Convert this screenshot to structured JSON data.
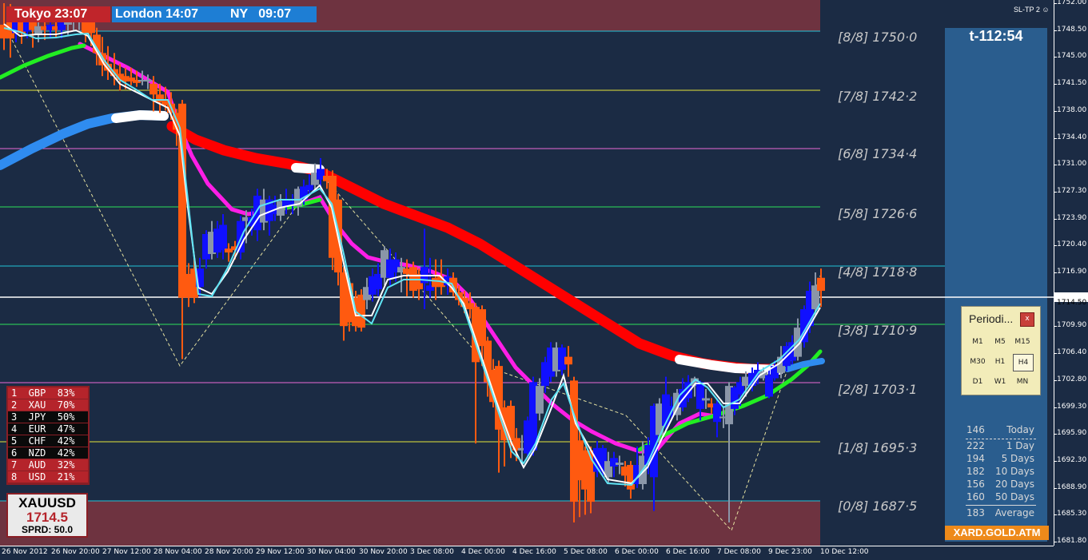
{
  "sessions": {
    "tokyo": "Tokyo 23:07",
    "london": "London 14:07",
    "ny": "NY   09:07"
  },
  "indicator_label": "SL-TP 2",
  "countdown": "t-112:54",
  "murrey_levels": [
    "[8/8] 1750·0",
    "[7/8] 1742·2",
    "[6/8] 1734·4",
    "[5/8] 1726·6",
    "[4/8] 1718·8",
    "[3/8] 1710·9",
    "[2/8] 1703·1",
    "[1/8] 1695·3",
    "[0/8] 1687·5"
  ],
  "price_axis": [
    "1752.00",
    "1748.50",
    "1745.00",
    "1741.50",
    "1738.00",
    "1734.40",
    "1731.00",
    "1727.30",
    "1723.90",
    "1720.40",
    "1716.90",
    "1713.40",
    "1709.90",
    "1706.40",
    "1702.80",
    "1699.30",
    "1695.90",
    "1692.30",
    "1688.90",
    "1685.30",
    "1681.80"
  ],
  "current_price_label": "1714.50",
  "time_axis": [
    "26 Nov 2012",
    "26 Nov 20:00",
    "27 Nov 12:00",
    "28 Nov 04:00",
    "28 Nov 20:00",
    "29 Nov 12:00",
    "30 Nov 04:00",
    "30 Nov 20:00",
    "3 Dec 08:00",
    "4 Dec 00:00",
    "4 Dec 16:00",
    "5 Dec 08:00",
    "6 Dec 00:00",
    "6 Dec 16:00",
    "7 Dec 08:00",
    "9 Dec 23:00",
    "10 Dec 12:00"
  ],
  "currency_strength": [
    {
      "text": "1  GBP  83%",
      "color": "#b5242b"
    },
    {
      "text": "2  XAU  70%",
      "color": "#b5242b"
    },
    {
      "text": "3  JPY  50%",
      "color": "#0a0a0a"
    },
    {
      "text": "4  EUR  47%",
      "color": "#0a0a0a"
    },
    {
      "text": "5  CHF  42%",
      "color": "#0a0a0a"
    },
    {
      "text": "6  NZD  42%",
      "color": "#0a0a0a"
    },
    {
      "text": "7  AUD  32%",
      "color": "#b5242b"
    },
    {
      "text": "8  USD  21%",
      "color": "#b5242b"
    }
  ],
  "symbol_box": {
    "symbol": "XAUUSD",
    "price": "1714.5",
    "spread": "SPRD: 50.0"
  },
  "periodicity": {
    "title": "Periodi...",
    "close": "x",
    "buttons": [
      "M1",
      "M5",
      "M15",
      "M30",
      "H1",
      "H4",
      "D1",
      "W1",
      "MN"
    ],
    "active": "H4"
  },
  "range_stats": [
    {
      "value": "146",
      "label": "Today"
    },
    {
      "value": "222",
      "label": "1 Day"
    },
    {
      "value": "194",
      "label": "5 Days"
    },
    {
      "value": "182",
      "label": "10 Days"
    },
    {
      "value": "156",
      "label": "20 Days"
    },
    {
      "value": "160",
      "label": "50 Days"
    },
    {
      "value": "183",
      "label": "Average"
    }
  ],
  "brand": "XARD.GOLD.ATM",
  "colors": {
    "background": "#1b2b44",
    "bull": "#1010ff",
    "bear": "#ff5a10",
    "neutral": "#8a96a8",
    "ma_red": "#ff0000",
    "ma_magenta": "#ff1ee6",
    "ma_green": "#22ee22",
    "ma_blue": "#2f8cf0",
    "panel": "#2a5d8e",
    "zone": "#6e3340"
  },
  "chart_data": {
    "type": "candlestick",
    "symbol": "XAUUSD",
    "timeframe": "H4",
    "ylim": [
      1681.8,
      1752.0
    ],
    "murrey": [
      1750.0,
      1742.2,
      1734.4,
      1726.6,
      1718.8,
      1710.9,
      1703.1,
      1695.3,
      1687.5
    ],
    "current_price": 1714.5,
    "candles": [
      {
        "x": 5,
        "o": 1749.2,
        "c": 1747.4,
        "h": 1752.0,
        "l": 1745.9
      },
      {
        "x": 13,
        "o": 1750.5,
        "c": 1747.4,
        "h": 1751.9,
        "l": 1744.9
      },
      {
        "x": 20,
        "o": 1748.1,
        "c": 1750.2,
        "h": 1750.9,
        "l": 1746.9
      },
      {
        "x": 27,
        "o": 1749.7,
        "c": 1748.1,
        "h": 1750.4,
        "l": 1746.7
      },
      {
        "x": 34,
        "o": 1748.3,
        "c": 1749.5,
        "h": 1751.4,
        "l": 1747.4
      },
      {
        "x": 41,
        "o": 1749.5,
        "c": 1748.5,
        "h": 1750.2,
        "l": 1746.2
      },
      {
        "x": 48,
        "o": 1748.0,
        "c": 1749.0,
        "h": 1750.2,
        "l": 1746.9
      },
      {
        "x": 56,
        "o": 1749.0,
        "c": 1748.5,
        "h": 1750.2,
        "l": 1747.2
      },
      {
        "x": 63,
        "o": 1748.5,
        "c": 1749.2,
        "h": 1750.4,
        "l": 1747.4
      },
      {
        "x": 70,
        "o": 1749.0,
        "c": 1748.5,
        "h": 1750.2,
        "l": 1747.6
      },
      {
        "x": 77,
        "o": 1748.5,
        "c": 1749.5,
        "h": 1750.4,
        "l": 1747.4
      },
      {
        "x": 85,
        "o": 1749.2,
        "c": 1749.5,
        "h": 1750.7,
        "l": 1747.9
      },
      {
        "x": 92,
        "o": 1749.7,
        "c": 1750.0,
        "h": 1751.2,
        "l": 1748.5
      },
      {
        "x": 99,
        "o": 1749.7,
        "c": 1749.5,
        "h": 1750.7,
        "l": 1748.5
      },
      {
        "x": 107,
        "o": 1750.0,
        "c": 1747.9,
        "h": 1750.7,
        "l": 1746.9
      },
      {
        "x": 114,
        "o": 1750.2,
        "c": 1748.1,
        "h": 1750.4,
        "l": 1746.4
      },
      {
        "x": 121,
        "o": 1747.9,
        "c": 1745.5,
        "h": 1748.8,
        "l": 1743.9
      },
      {
        "x": 128,
        "o": 1745.5,
        "c": 1743.9,
        "h": 1747.6,
        "l": 1742.5
      },
      {
        "x": 135,
        "o": 1744.1,
        "c": 1743.2,
        "h": 1746.4,
        "l": 1742.0
      },
      {
        "x": 143,
        "o": 1743.4,
        "c": 1742.5,
        "h": 1745.5,
        "l": 1741.3
      },
      {
        "x": 150,
        "o": 1742.8,
        "c": 1742.0,
        "h": 1744.1,
        "l": 1740.6
      },
      {
        "x": 157,
        "o": 1742.5,
        "c": 1741.8,
        "h": 1743.6,
        "l": 1740.8
      },
      {
        "x": 164,
        "o": 1742.3,
        "c": 1741.8,
        "h": 1743.6,
        "l": 1741.3
      },
      {
        "x": 171,
        "o": 1742.0,
        "c": 1741.6,
        "h": 1743.2,
        "l": 1741.1
      },
      {
        "x": 178,
        "o": 1742.0,
        "c": 1741.8,
        "h": 1743.2,
        "l": 1741.3
      },
      {
        "x": 185,
        "o": 1742.0,
        "c": 1741.8,
        "h": 1742.7,
        "l": 1740.8
      },
      {
        "x": 192,
        "o": 1741.5,
        "c": 1740.1,
        "h": 1742.5,
        "l": 1737.9
      },
      {
        "x": 200,
        "o": 1740.1,
        "c": 1739.1,
        "h": 1741.5,
        "l": 1737.7
      },
      {
        "x": 207,
        "o": 1739.4,
        "c": 1738.7,
        "h": 1741.1,
        "l": 1738.0
      },
      {
        "x": 214,
        "o": 1738.9,
        "c": 1737.7,
        "h": 1740.4,
        "l": 1736.8
      },
      {
        "x": 221,
        "o": 1737.7,
        "c": 1735.5,
        "h": 1738.2,
        "l": 1733.4
      },
      {
        "x": 228,
        "o": 1738.9,
        "c": 1713.6,
        "h": 1739.4,
        "l": 1705.6
      },
      {
        "x": 236,
        "o": 1716.7,
        "c": 1713.6,
        "h": 1718.1,
        "l": 1712.4
      },
      {
        "x": 243,
        "o": 1717.4,
        "c": 1713.6,
        "h": 1718.8,
        "l": 1712.9
      },
      {
        "x": 250,
        "o": 1715.0,
        "c": 1717.4,
        "h": 1718.8,
        "l": 1713.8
      },
      {
        "x": 258,
        "o": 1718.6,
        "c": 1721.9,
        "h": 1722.4,
        "l": 1717.4
      },
      {
        "x": 265,
        "o": 1719.3,
        "c": 1722.2,
        "h": 1723.6,
        "l": 1718.6
      },
      {
        "x": 272,
        "o": 1719.5,
        "c": 1722.6,
        "h": 1723.6,
        "l": 1718.8
      },
      {
        "x": 279,
        "o": 1719.8,
        "c": 1723.1,
        "h": 1724.5,
        "l": 1718.6
      },
      {
        "x": 286,
        "o": 1720.0,
        "c": 1719.5,
        "h": 1720.7,
        "l": 1718.3
      },
      {
        "x": 294,
        "o": 1720.3,
        "c": 1719.8,
        "h": 1721.0,
        "l": 1718.6
      },
      {
        "x": 301,
        "o": 1719.5,
        "c": 1723.6,
        "h": 1724.3,
        "l": 1718.6
      },
      {
        "x": 308,
        "o": 1723.6,
        "c": 1724.1,
        "h": 1725.0,
        "l": 1720.7
      },
      {
        "x": 315,
        "o": 1722.9,
        "c": 1724.1,
        "h": 1725.2,
        "l": 1721.7
      },
      {
        "x": 322,
        "o": 1722.4,
        "c": 1726.9,
        "h": 1727.8,
        "l": 1721.0
      },
      {
        "x": 330,
        "o": 1723.4,
        "c": 1726.4,
        "h": 1727.8,
        "l": 1722.4
      },
      {
        "x": 337,
        "o": 1723.6,
        "c": 1726.4,
        "h": 1726.9,
        "l": 1721.7
      },
      {
        "x": 344,
        "o": 1724.5,
        "c": 1725.7,
        "h": 1726.9,
        "l": 1723.6
      },
      {
        "x": 351,
        "o": 1724.3,
        "c": 1726.2,
        "h": 1727.1,
        "l": 1723.6
      },
      {
        "x": 358,
        "o": 1725.5,
        "c": 1726.4,
        "h": 1727.8,
        "l": 1724.5
      },
      {
        "x": 366,
        "o": 1725.7,
        "c": 1726.2,
        "h": 1727.1,
        "l": 1724.5
      },
      {
        "x": 373,
        "o": 1725.5,
        "c": 1727.8,
        "h": 1728.1,
        "l": 1724.3
      },
      {
        "x": 380,
        "o": 1726.4,
        "c": 1728.1,
        "h": 1729.0,
        "l": 1725.7
      },
      {
        "x": 387,
        "o": 1727.6,
        "c": 1728.3,
        "h": 1729.7,
        "l": 1726.9
      },
      {
        "x": 394,
        "o": 1728.3,
        "c": 1729.9,
        "h": 1731.1,
        "l": 1727.6
      },
      {
        "x": 401,
        "o": 1729.0,
        "c": 1730.4,
        "h": 1731.8,
        "l": 1727.8
      },
      {
        "x": 409,
        "o": 1729.5,
        "c": 1728.8,
        "h": 1730.4,
        "l": 1727.8
      },
      {
        "x": 416,
        "o": 1729.5,
        "c": 1718.8,
        "h": 1730.2,
        "l": 1717.2
      },
      {
        "x": 423,
        "o": 1726.4,
        "c": 1716.9,
        "h": 1727.1,
        "l": 1715.2
      },
      {
        "x": 430,
        "o": 1716.9,
        "c": 1709.9,
        "h": 1717.6,
        "l": 1708.0
      },
      {
        "x": 437,
        "o": 1715.5,
        "c": 1710.4,
        "h": 1716.2,
        "l": 1709.2
      },
      {
        "x": 445,
        "o": 1713.6,
        "c": 1709.9,
        "h": 1714.5,
        "l": 1709.2
      },
      {
        "x": 452,
        "o": 1714.0,
        "c": 1709.7,
        "h": 1714.7,
        "l": 1709.2
      },
      {
        "x": 459,
        "o": 1713.3,
        "c": 1715.0,
        "h": 1716.2,
        "l": 1712.1
      },
      {
        "x": 466,
        "o": 1714.0,
        "c": 1716.4,
        "h": 1717.4,
        "l": 1713.1
      },
      {
        "x": 473,
        "o": 1714.7,
        "c": 1716.7,
        "h": 1718.1,
        "l": 1713.8
      },
      {
        "x": 481,
        "o": 1716.2,
        "c": 1719.8,
        "h": 1720.3,
        "l": 1715.2
      },
      {
        "x": 488,
        "o": 1716.2,
        "c": 1718.6,
        "h": 1720.0,
        "l": 1715.2
      },
      {
        "x": 495,
        "o": 1716.9,
        "c": 1718.6,
        "h": 1719.5,
        "l": 1715.7
      },
      {
        "x": 502,
        "o": 1716.9,
        "c": 1717.6,
        "h": 1718.8,
        "l": 1714.3
      },
      {
        "x": 509,
        "o": 1717.4,
        "c": 1716.7,
        "h": 1718.6,
        "l": 1713.8
      },
      {
        "x": 517,
        "o": 1717.6,
        "c": 1714.5,
        "h": 1718.3,
        "l": 1713.6
      },
      {
        "x": 524,
        "o": 1716.7,
        "c": 1714.7,
        "h": 1717.4,
        "l": 1713.3
      },
      {
        "x": 531,
        "o": 1715.5,
        "c": 1717.6,
        "h": 1722.6,
        "l": 1712.1
      },
      {
        "x": 538,
        "o": 1714.5,
        "c": 1715.2,
        "h": 1718.8,
        "l": 1713.6
      },
      {
        "x": 545,
        "o": 1716.2,
        "c": 1715.0,
        "h": 1718.6,
        "l": 1713.3
      },
      {
        "x": 552,
        "o": 1716.4,
        "c": 1715.0,
        "h": 1718.6,
        "l": 1714.0
      },
      {
        "x": 560,
        "o": 1715.2,
        "c": 1716.4,
        "h": 1717.4,
        "l": 1714.0
      },
      {
        "x": 567,
        "o": 1716.2,
        "c": 1714.3,
        "h": 1716.9,
        "l": 1713.8
      },
      {
        "x": 574,
        "o": 1714.3,
        "c": 1713.3,
        "h": 1715.2,
        "l": 1712.6
      },
      {
        "x": 581,
        "o": 1713.6,
        "c": 1712.4,
        "h": 1714.5,
        "l": 1711.6
      },
      {
        "x": 588,
        "o": 1712.9,
        "c": 1712.1,
        "h": 1714.3,
        "l": 1710.9
      },
      {
        "x": 595,
        "o": 1712.4,
        "c": 1705.2,
        "h": 1712.9,
        "l": 1694.6
      },
      {
        "x": 603,
        "o": 1712.1,
        "c": 1707.3,
        "h": 1712.6,
        "l": 1704.7
      },
      {
        "x": 610,
        "o": 1708.0,
        "c": 1702.6,
        "h": 1708.5,
        "l": 1700.7
      },
      {
        "x": 617,
        "o": 1704.2,
        "c": 1700.0,
        "h": 1705.6,
        "l": 1699.3
      },
      {
        "x": 624,
        "o": 1704.7,
        "c": 1696.4,
        "h": 1705.4,
        "l": 1690.8
      },
      {
        "x": 631,
        "o": 1699.3,
        "c": 1695.0,
        "h": 1700.2,
        "l": 1691.6
      },
      {
        "x": 639,
        "o": 1699.5,
        "c": 1695.0,
        "h": 1700.2,
        "l": 1692.7
      },
      {
        "x": 646,
        "o": 1695.3,
        "c": 1693.7,
        "h": 1696.6,
        "l": 1692.3
      },
      {
        "x": 653,
        "o": 1693.7,
        "c": 1694.0,
        "h": 1695.7,
        "l": 1692.3
      },
      {
        "x": 660,
        "o": 1693.3,
        "c": 1697.6,
        "h": 1698.1,
        "l": 1692.7
      },
      {
        "x": 667,
        "o": 1693.7,
        "c": 1702.6,
        "h": 1703.3,
        "l": 1693.0
      },
      {
        "x": 675,
        "o": 1698.5,
        "c": 1702.1,
        "h": 1703.1,
        "l": 1697.6
      },
      {
        "x": 682,
        "o": 1702.1,
        "c": 1705.2,
        "h": 1705.9,
        "l": 1701.2
      },
      {
        "x": 689,
        "o": 1703.3,
        "c": 1707.1,
        "h": 1707.8,
        "l": 1702.6
      },
      {
        "x": 696,
        "o": 1704.0,
        "c": 1707.1,
        "h": 1707.8,
        "l": 1703.3
      },
      {
        "x": 703,
        "o": 1704.2,
        "c": 1707.1,
        "h": 1707.5,
        "l": 1703.5
      },
      {
        "x": 711,
        "o": 1705.9,
        "c": 1704.9,
        "h": 1707.3,
        "l": 1703.3
      },
      {
        "x": 718,
        "o": 1702.8,
        "c": 1687.0,
        "h": 1703.3,
        "l": 1684.3
      },
      {
        "x": 725,
        "o": 1695.0,
        "c": 1689.8,
        "h": 1696.4,
        "l": 1685.0
      },
      {
        "x": 732,
        "o": 1693.7,
        "c": 1688.6,
        "h": 1694.2,
        "l": 1685.3
      },
      {
        "x": 739,
        "o": 1693.7,
        "c": 1687.0,
        "h": 1694.2,
        "l": 1685.5
      },
      {
        "x": 747,
        "o": 1690.9,
        "c": 1694.0,
        "h": 1694.9,
        "l": 1690.2
      },
      {
        "x": 754,
        "o": 1690.9,
        "c": 1694.0,
        "h": 1694.4,
        "l": 1690.2
      },
      {
        "x": 761,
        "o": 1690.2,
        "c": 1692.3,
        "h": 1693.5,
        "l": 1689.3
      },
      {
        "x": 768,
        "o": 1691.6,
        "c": 1692.7,
        "h": 1693.5,
        "l": 1690.2
      },
      {
        "x": 775,
        "o": 1691.8,
        "c": 1692.1,
        "h": 1693.0,
        "l": 1690.6
      },
      {
        "x": 782,
        "o": 1691.6,
        "c": 1690.4,
        "h": 1692.3,
        "l": 1689.0
      },
      {
        "x": 789,
        "o": 1691.8,
        "c": 1688.6,
        "h": 1692.3,
        "l": 1687.4
      },
      {
        "x": 797,
        "o": 1689.3,
        "c": 1691.8,
        "h": 1694.2,
        "l": 1688.8
      },
      {
        "x": 804,
        "o": 1689.3,
        "c": 1693.0,
        "h": 1694.9,
        "l": 1688.6
      },
      {
        "x": 811,
        "o": 1691.8,
        "c": 1694.4,
        "h": 1695.4,
        "l": 1690.6
      },
      {
        "x": 818,
        "o": 1690.2,
        "c": 1699.5,
        "h": 1699.8,
        "l": 1685.8
      },
      {
        "x": 825,
        "o": 1695.7,
        "c": 1699.8,
        "h": 1700.5,
        "l": 1694.7
      },
      {
        "x": 833,
        "o": 1696.9,
        "c": 1701.0,
        "h": 1703.3,
        "l": 1696.4
      },
      {
        "x": 840,
        "o": 1698.3,
        "c": 1699.5,
        "h": 1700.7,
        "l": 1697.6
      },
      {
        "x": 847,
        "o": 1698.3,
        "c": 1701.2,
        "h": 1701.7,
        "l": 1697.6
      },
      {
        "x": 854,
        "o": 1699.3,
        "c": 1701.7,
        "h": 1703.1,
        "l": 1698.8
      },
      {
        "x": 861,
        "o": 1700.5,
        "c": 1702.6,
        "h": 1703.5,
        "l": 1700.0
      },
      {
        "x": 869,
        "o": 1702.1,
        "c": 1703.1,
        "h": 1703.3,
        "l": 1700.7
      },
      {
        "x": 876,
        "o": 1699.1,
        "c": 1702.6,
        "h": 1702.8,
        "l": 1697.6
      },
      {
        "x": 883,
        "o": 1700.5,
        "c": 1700.2,
        "h": 1701.7,
        "l": 1699.1
      },
      {
        "x": 890,
        "o": 1699.8,
        "c": 1699.3,
        "h": 1700.5,
        "l": 1698.5
      },
      {
        "x": 897,
        "o": 1697.4,
        "c": 1699.8,
        "h": 1700.5,
        "l": 1695.4
      },
      {
        "x": 905,
        "o": 1698.1,
        "c": 1698.1,
        "h": 1699.5,
        "l": 1696.6
      },
      {
        "x": 912,
        "o": 1697.1,
        "c": 1702.1,
        "h": 1702.6,
        "l": 1684.3
      },
      {
        "x": 919,
        "o": 1699.1,
        "c": 1701.9,
        "h": 1702.1,
        "l": 1698.3
      },
      {
        "x": 926,
        "o": 1701.0,
        "c": 1702.6,
        "h": 1703.3,
        "l": 1699.5
      },
      {
        "x": 933,
        "o": 1702.1,
        "c": 1703.3,
        "h": 1704.0,
        "l": 1700.7
      },
      {
        "x": 941,
        "o": 1702.1,
        "c": 1703.8,
        "h": 1704.5,
        "l": 1701.4
      },
      {
        "x": 948,
        "o": 1703.1,
        "c": 1704.2,
        "h": 1705.2,
        "l": 1702.3
      },
      {
        "x": 955,
        "o": 1703.1,
        "c": 1704.0,
        "h": 1704.5,
        "l": 1702.8
      },
      {
        "x": 962,
        "o": 1700.7,
        "c": 1703.5,
        "h": 1704.2,
        "l": 1700.5
      },
      {
        "x": 969,
        "o": 1703.1,
        "c": 1704.7,
        "h": 1705.4,
        "l": 1702.8
      },
      {
        "x": 977,
        "o": 1703.8,
        "c": 1705.9,
        "h": 1707.3,
        "l": 1703.1
      },
      {
        "x": 984,
        "o": 1704.7,
        "c": 1707.3,
        "h": 1707.8,
        "l": 1704.0
      },
      {
        "x": 991,
        "o": 1705.4,
        "c": 1707.8,
        "h": 1708.7,
        "l": 1704.9
      },
      {
        "x": 998,
        "o": 1705.9,
        "c": 1709.7,
        "h": 1710.9,
        "l": 1705.4
      },
      {
        "x": 1006,
        "o": 1707.8,
        "c": 1712.1,
        "h": 1712.6,
        "l": 1707.1
      },
      {
        "x": 1013,
        "o": 1709.9,
        "c": 1714.5,
        "h": 1715.7,
        "l": 1709.0
      },
      {
        "x": 1020,
        "o": 1712.1,
        "c": 1715.2,
        "h": 1716.9,
        "l": 1711.4
      },
      {
        "x": 1027,
        "o": 1716.2,
        "c": 1714.5,
        "h": 1717.4,
        "l": 1712.4
      }
    ]
  }
}
